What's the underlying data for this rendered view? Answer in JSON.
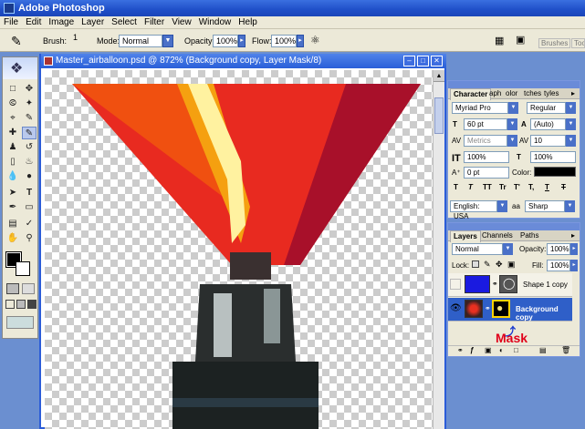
{
  "app": {
    "title": "Adobe Photoshop"
  },
  "menu": [
    "File",
    "Edit",
    "Image",
    "Layer",
    "Select",
    "Filter",
    "View",
    "Window",
    "Help"
  ],
  "options": {
    "brush_label": "Brush:",
    "brush_size": "1",
    "mode_label": "Mode:",
    "mode_value": "Normal",
    "opacity_label": "Opacity:",
    "opacity_value": "100%",
    "flow_label": "Flow:",
    "flow_value": "100%",
    "well_tabs": [
      "Brushes",
      "Tool"
    ]
  },
  "document": {
    "title": "Master_airballoon.psd @ 872% (Background copy, Layer Mask/8)"
  },
  "character": {
    "tabs": [
      "Character",
      "aph",
      "olor",
      "tches",
      "tyles"
    ],
    "font_family": "Myriad Pro",
    "font_style": "Regular",
    "size": "60 pt",
    "leading": "(Auto)",
    "kerning": "Metrics",
    "tracking": "10",
    "vscale": "100%",
    "hscale": "100%",
    "baseline": "0 pt",
    "color_label": "Color:",
    "language": "English: USA",
    "antialias": "Sharp",
    "style_buttons": [
      "T",
      "T",
      "TT",
      "Tr",
      "T'",
      "T,",
      "T",
      "T"
    ]
  },
  "layers": {
    "tabs": [
      "Layers",
      "Channels",
      "Paths"
    ],
    "blend_mode": "Normal",
    "opacity_label": "Opacity:",
    "opacity_value": "100%",
    "lock_label": "Lock:",
    "fill_label": "Fill:",
    "fill_value": "100%",
    "items": [
      {
        "name": "Shape 1 copy"
      },
      {
        "name": "Background copy"
      }
    ],
    "annotation": "Mask"
  },
  "colors": {
    "accent": "#2b5cd8",
    "selection": "#2f5fc8",
    "annotation": "#e0001a",
    "shape_fill": "#1a1ae0"
  }
}
